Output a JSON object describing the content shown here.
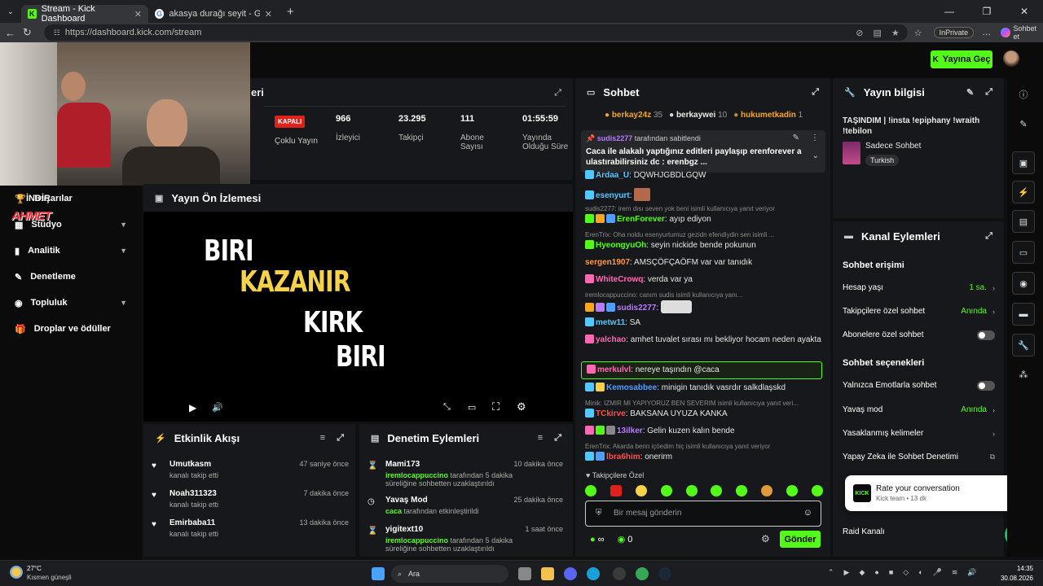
{
  "browser": {
    "tabs": [
      {
        "label": "Stream - Kick Dashboard",
        "active": true
      },
      {
        "label": "akasya durağı seyit - Google'da A",
        "active": false
      }
    ],
    "url": "https://dashboard.kick.com/stream",
    "inprivate": "InPrivate",
    "chat_label": "Sohbet et"
  },
  "header": {
    "go_live": "Yayına Geç"
  },
  "overlay": {
    "indir": "İNDİR",
    "ahmet": "AHMET"
  },
  "sidebar": {
    "items": [
      {
        "label": "Başarılar",
        "icon": "trophy-icon"
      },
      {
        "label": "Stüdyo",
        "icon": "studio-icon"
      },
      {
        "label": "Analitik",
        "icon": "analytics-icon"
      },
      {
        "label": "Denetleme",
        "icon": "moderation-icon"
      },
      {
        "label": "Topluluk",
        "icon": "community-icon"
      },
      {
        "label": "Droplar ve ödüller",
        "icon": "gift-icon"
      }
    ]
  },
  "stats": {
    "title_partial": "eri",
    "status": "KAPALI",
    "multi": "Çoklu Yayın",
    "viewers": {
      "value": "966",
      "label": "İzleyici"
    },
    "followers": {
      "value": "23.295",
      "label": "Takipçi"
    },
    "subs": {
      "value": "111",
      "label": "Abone Sayısı"
    },
    "duration": {
      "value": "01:55:59",
      "label": "Yayında Olduğu Süre"
    }
  },
  "preview": {
    "title": "Yayın Ön İzlemesi",
    "line1": "BIRI",
    "line2": "KAZANIR",
    "line3": "KIRK",
    "line4": "BIRI"
  },
  "activity": {
    "title": "Etkinlik Akışı",
    "items": [
      {
        "user": "Umutkasm",
        "text": "kanalı takip etti",
        "time": "47 saniye önce"
      },
      {
        "user": "Noah311323",
        "text": "kanalı takip etti",
        "time": "7 dakika önce"
      },
      {
        "user": "Emirbaba11",
        "text": "kanalı takip etti",
        "time": "13 dakika önce"
      }
    ]
  },
  "modlog": {
    "title": "Denetim Eylemleri",
    "items": [
      {
        "user": "Mami173",
        "by": "iremlocappuccino",
        "text": " tarafından 5 dakika süreliğine sohbetten uzaklaştırıldı",
        "time": "10 dakika önce"
      },
      {
        "user": "Yavaş Mod",
        "by": "caca",
        "text": " tarafından etkinleştirildi",
        "time": "25 dakika önce"
      },
      {
        "user": "yigitext10",
        "by": "iremlocappuccino",
        "text": " tarafından 5 dakika süreliğine sohbetten uzaklaştırıldı",
        "time": "1 saat önce"
      }
    ]
  },
  "chat": {
    "title": "Sohbet",
    "top_gifters": [
      {
        "name": "berkay24z",
        "count": "35"
      },
      {
        "name": "berkaywei",
        "count": "10"
      },
      {
        "name": "hukumetkadin",
        "count": "1"
      }
    ],
    "pinned": {
      "by": "sudis2277",
      "by_suffix": "tarafından sabitlendi",
      "text": "Caca ile alakalı yaptığınız editleri paylaşıp erenforever a ulastırabilirsiniz dc : erenbgz",
      "more": "..."
    },
    "messages": [
      {
        "user": "Ardaa_U",
        "text": ": DQWHJGBDLGQW",
        "color": "#53c7ff"
      },
      {
        "user": "esenyurt",
        "text": ":",
        "color": "#53c7ff"
      },
      {
        "reply": "sudis2277: irem dısı seven yok beni isimli kullanıcıya yanıt veriyor"
      },
      {
        "user": "ErenForever",
        "text": ": ayıp ediyon",
        "color": "#53fc18"
      },
      {
        "reply": "ErenTrix: Oha noldu esenyurtumuz gezidn efendiydin sen isimli ..."
      },
      {
        "user": "HyeongyuOh",
        "text": ": seyin nickide bende pokunun",
        "color": "#53fc18"
      },
      {
        "user": "sergen1907",
        "text": ": AMSÇÖFÇAÖFM var var tanıdık",
        "color": "#ff9a3c"
      },
      {
        "user": "WhiteCrowq",
        "text": ": verda var ya",
        "color": "#ff69b4"
      },
      {
        "reply": "iremlocappuccino: canım sudis isimli kullanıcıya yanı..."
      },
      {
        "user": "sudis2277",
        "text": ":",
        "color": "#b77bff"
      },
      {
        "user": "metw11",
        "text": ": SA",
        "color": "#53c7ff"
      },
      {
        "user": "yalchao",
        "text": ": amhet tuvalet sırası mı bekliyor hocam neden ayakta",
        "color": "#ff69b4"
      },
      {
        "user": "merkulvl",
        "text": ": nereye taşındın @caca",
        "color": "#ff69b4"
      },
      {
        "user": "Kemosabbee",
        "text": ": minigin tanıdık vasrdır salkdlaşskd",
        "color": "#4f9dff"
      },
      {
        "reply": "Minik: IZMIR MI YAPIYORUZ BEN SEVERIM isimli kullanıcıya yanıt veri..."
      },
      {
        "user": "TCkirve",
        "text": ": BAKSANA UYUZA KANKA",
        "color": "#ff4d4d"
      },
      {
        "user": "13ilker",
        "text": ": Gelin kuzen kalın bende",
        "color": "#b77bff"
      },
      {
        "reply": "ErenTrix: Akarda benn içöedim hiç isimli kullanıcıya yanıt veriyor"
      },
      {
        "user": "lbra6him",
        "text": ": onerirm",
        "color": "#ff4d4d"
      }
    ],
    "followers_only": "Takipçilere Özel",
    "input_placeholder": "Bir mesaj gönderin",
    "points": "0",
    "send": "Gönder"
  },
  "stream_info": {
    "title": "Yayın bilgisi",
    "stream_title": "TAŞINDIM | !insta !epiphany !wraith !tebilon",
    "category": "Sadece Sohbet",
    "tag": "Turkish"
  },
  "channel_actions": {
    "title": "Kanal Eylemleri",
    "access_title": "Sohbet erişimi",
    "account_age": {
      "label": "Hesap yaşı",
      "value": "1 sa."
    },
    "followers_chat": {
      "label": "Takipçilere özel sohbet",
      "value": "Anında"
    },
    "subs_chat": {
      "label": "Abonelere özel sohbet"
    },
    "options_title": "Sohbet seçenekleri",
    "emote_only": {
      "label": "Yalnızca Emotlarla sohbet"
    },
    "slow_mode": {
      "label": "Yavaş mod",
      "value": "Anında"
    },
    "banned_words": {
      "label": "Yasaklanmış kelimeler"
    },
    "ai_mod": {
      "label": "Yapay Zeka ile Sohbet Denetimi"
    },
    "raid": {
      "label": "Raid Kanalı"
    }
  },
  "toast": {
    "title": "Rate your conversation",
    "sub": "Kick team • 13 dk",
    "badge": "1"
  },
  "taskbar": {
    "weather_temp": "27°C",
    "weather_desc": "Kısmen güneşli",
    "search": "Ara",
    "time": "14:35",
    "date": "30.08.2026"
  },
  "colors": {
    "kick_green": "#53fc18",
    "panel": "#17181b",
    "bg": "#0f1012"
  }
}
